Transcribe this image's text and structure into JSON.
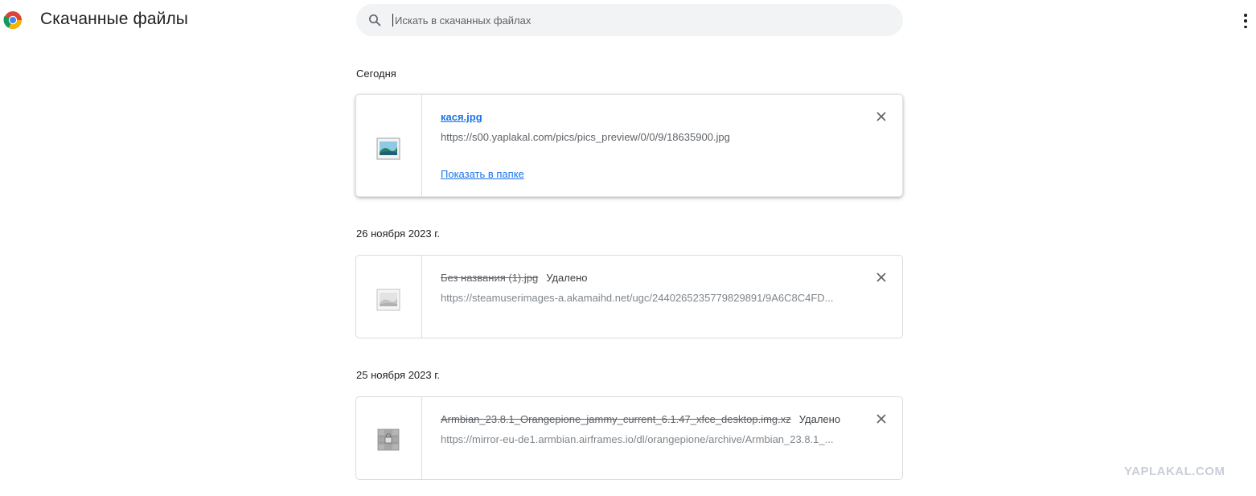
{
  "header": {
    "title": "Скачанные файлы",
    "logo_icon": "chrome-logo-icon",
    "search": {
      "placeholder": "Искать в скачанных файлах",
      "value": ""
    },
    "menu_icon": "more-vert-icon"
  },
  "groups": [
    {
      "date": "Сегодня",
      "items": [
        {
          "name": "кася.jpg",
          "url": "https://s00.yaplakal.com/pics/pics_preview/0/0/9/18635900.jpg",
          "action": "Показать в папке",
          "status": "",
          "icon": "image-file-icon"
        }
      ]
    },
    {
      "date": "26 ноября 2023 г.",
      "items": [
        {
          "name": "Без названия (1).jpg",
          "url": "https://steamuserimages-a.akamaihd.net/ugc/2440265235779829891/9A6C8C4FD...",
          "status": "Удалено",
          "icon": "image-file-icon"
        }
      ]
    },
    {
      "date": "25 ноября 2023 г.",
      "items": [
        {
          "name": "Armbian_23.8.1_Orangepione_jammy_current_6.1.47_xfce_desktop.img.xz",
          "url": "https://mirror-eu-de1.armbian.airframes.io/dl/orangepione/archive/Armbian_23.8.1_...",
          "status": "Удалено",
          "icon": "archive-file-icon"
        }
      ]
    }
  ],
  "watermark": "YAPLAKAL.COM",
  "colors": {
    "link": "#1a73e8",
    "search_bg": "#f1f3f4",
    "border": "#dadce0"
  }
}
